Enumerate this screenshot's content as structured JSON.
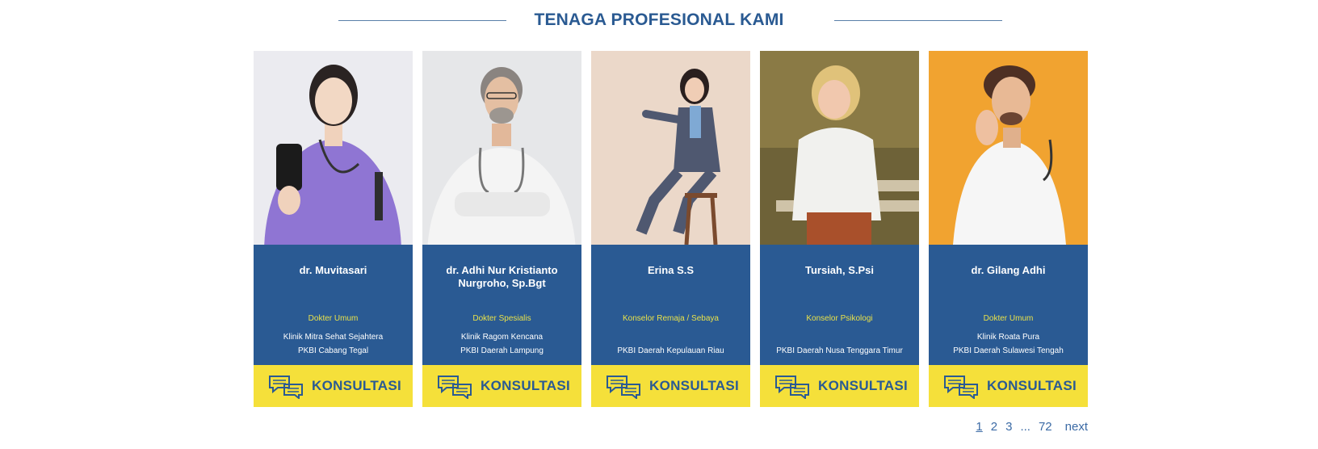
{
  "section": {
    "title": "TENAGA PROFESIONAL KAMI"
  },
  "cards": [
    {
      "name": "dr. Muvitasari",
      "role": "Dokter Umum",
      "loc1": "Klinik Mitra Sehat Sejahtera",
      "loc2": "PKBI Cabang Tegal",
      "button": "KONSULTASI"
    },
    {
      "name": "dr.  Adhi Nur Kristianto Nurgroho, Sp.Bgt",
      "role": "Dokter Spesialis",
      "loc1": "Klinik Ragom Kencana",
      "loc2": "PKBI Daerah Lampung",
      "button": "KONSULTASI"
    },
    {
      "name": "Erina S.S",
      "role": "Konselor Remaja / Sebaya",
      "loc1": "",
      "loc2": "PKBI Daerah Kepulauan Riau",
      "button": "KONSULTASI"
    },
    {
      "name": "Tursiah, S.Psi",
      "role": "Konselor Psikologi",
      "loc1": "",
      "loc2": "PKBI Daerah Nusa Tenggara Timur",
      "button": "KONSULTASI"
    },
    {
      "name": "dr. Gilang Adhi",
      "role": "Dokter Umum",
      "loc1": "Klinik Roata Pura",
      "loc2": "PKBI Daerah Sulawesi Tengah",
      "button": "KONSULTASI"
    }
  ],
  "pagination": {
    "p1": "1",
    "p2": "2",
    "p3": "3",
    "ellipsis": "...",
    "last": "72",
    "next": "next"
  },
  "colors": {
    "primary": "#2a5a93",
    "accent_yellow": "#f5e03a",
    "role_yellow": "#e8e14a"
  }
}
